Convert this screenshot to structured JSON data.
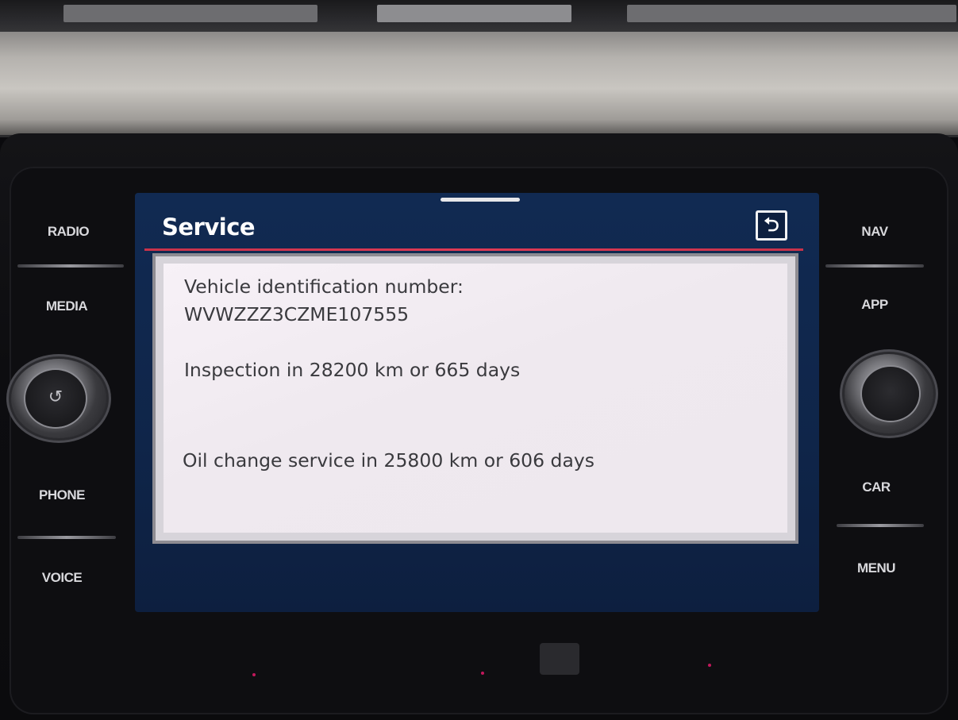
{
  "hardware_buttons": {
    "left": [
      {
        "name": "radio-button",
        "label": "RADIO"
      },
      {
        "name": "media-button",
        "label": "MEDIA"
      },
      {
        "name": "phone-button",
        "label": "PHONE"
      },
      {
        "name": "voice-button",
        "label": "VOICE"
      }
    ],
    "right": [
      {
        "name": "nav-button",
        "label": "NAV"
      },
      {
        "name": "app-button",
        "label": "APP"
      },
      {
        "name": "car-button",
        "label": "CAR"
      },
      {
        "name": "menu-button",
        "label": "MENU"
      }
    ]
  },
  "knobs": {
    "left_icon": "power-icon",
    "right_icon": "none"
  },
  "screen": {
    "title": "Service",
    "back_icon": "back-arrow-icon",
    "lines": {
      "vin_label": "Vehicle identification number:",
      "vin_value": "WVWZZZ3CZME107555",
      "inspection": "Inspection in 28200 km or 665 days",
      "oil_change": "Oil change service in 25800 km or 606 days"
    }
  },
  "colors": {
    "screen_background": "#112a52",
    "accent_rule": "#e03a55",
    "panel_background": "#f7f1f7",
    "text": "#3a3a3e"
  }
}
